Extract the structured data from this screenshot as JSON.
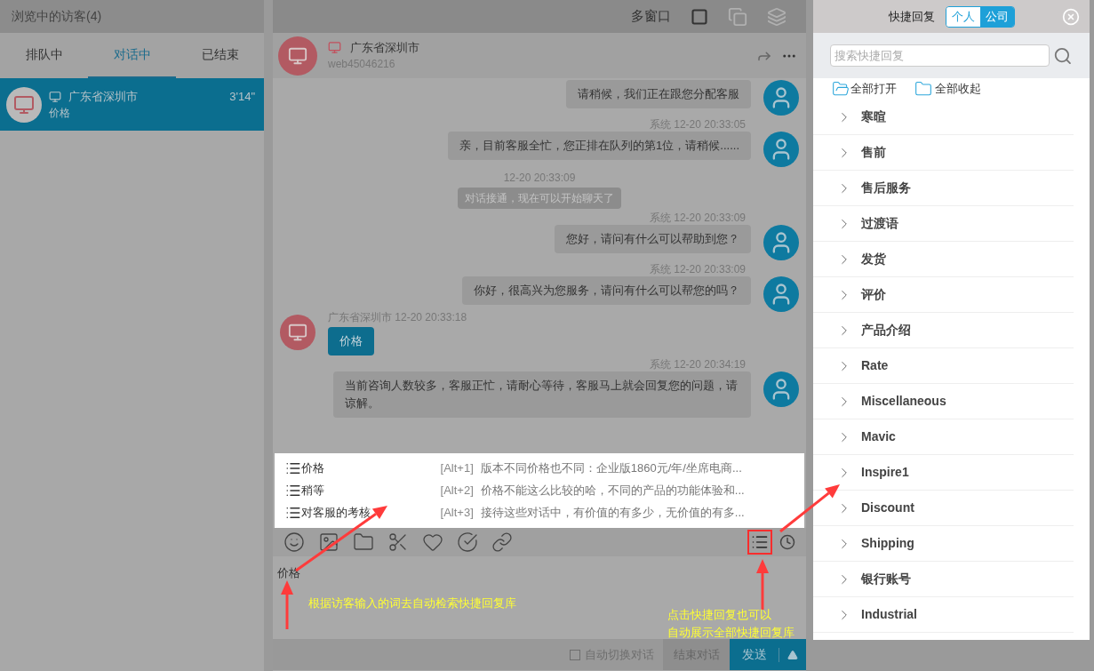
{
  "visitors_panel": {
    "title": "浏览中的访客(4)",
    "tabs": [
      {
        "label": "排队中",
        "selected": false
      },
      {
        "label": "对话中",
        "selected": true
      },
      {
        "label": "已结束",
        "selected": false
      }
    ],
    "sessions": [
      {
        "location": "广东省深圳市",
        "last_message": "价格",
        "duration": "3'14\"",
        "selected": true
      }
    ]
  },
  "chat": {
    "toolbar_label": "多窗口",
    "visitor": {
      "location": "广东省深圳市",
      "id": "web45046216"
    },
    "messages": [
      {
        "kind": "agent",
        "text": "请稍候，我们正在跟您分配客服"
      },
      {
        "kind": "agent",
        "sender": "系统",
        "time": "12-20 20:33:05",
        "text": "亲，目前客服全忙，您正排在队列的第1位，请稍候......"
      },
      {
        "kind": "notice",
        "time": "12-20 20:33:09",
        "text": "对话接通，现在可以开始聊天了"
      },
      {
        "kind": "agent",
        "sender": "系统",
        "time": "12-20 20:33:09",
        "text": "您好，请问有什么可以帮助到您？"
      },
      {
        "kind": "agent",
        "sender": "系统",
        "time": "12-20 20:33:09",
        "text": "你好，很高兴为您服务，请问有什么可以帮您的吗？"
      },
      {
        "kind": "visitor",
        "sender": "广东省深圳市",
        "time": "12-20 20:33:18",
        "text": "价格"
      },
      {
        "kind": "agent",
        "sender": "系统",
        "time": "12-20 20:34:19",
        "text": "当前咨询人数较多，客服正忙，请耐心等待，客服马上就会回复您的问题，请谅解。"
      }
    ],
    "suggestions": [
      {
        "title": "价格",
        "shortcut": "[Alt+1]",
        "preview": "版本不同价格也不同：企业版1860元/年/坐席电商..."
      },
      {
        "title": "稍等",
        "shortcut": "[Alt+2]",
        "preview": "价格不能这么比较的哈，不同的产品的功能体验和..."
      },
      {
        "title": "对客服的考核",
        "shortcut": "[Alt+3]",
        "preview": "接待这些对话中，有价值的有多少，无价值的有多..."
      }
    ],
    "input_value": "价格",
    "auto_switch": {
      "label": "自动切换对话",
      "checked": false
    },
    "end_button": "结束对话",
    "send_button": "发送"
  },
  "quick_replies": {
    "title": "快捷回复",
    "scopes": [
      {
        "label": "个人",
        "selected": false
      },
      {
        "label": "公司",
        "selected": true
      }
    ],
    "search": {
      "placeholder": "搜索快捷回复"
    },
    "expand_all": "全部打开",
    "collapse_all": "全部收起",
    "categories": [
      {
        "label": "寒暄"
      },
      {
        "label": "售前"
      },
      {
        "label": "售后服务"
      },
      {
        "label": "过渡语"
      },
      {
        "label": "发货"
      },
      {
        "label": "评价"
      },
      {
        "label": "产品介绍"
      },
      {
        "label": "Rate"
      },
      {
        "label": "Miscellaneous"
      },
      {
        "label": "Mavic"
      },
      {
        "label": "Inspire1"
      },
      {
        "label": "Discount"
      },
      {
        "label": "Shipping"
      },
      {
        "label": "银行账号"
      },
      {
        "label": "Industrial"
      }
    ]
  },
  "annotations": [
    {
      "lines": [
        "根据访客输入的词去自动检索快捷回复库"
      ]
    },
    {
      "lines": [
        "点击快捷回复也可以",
        "自动展示全部快捷回复库"
      ]
    }
  ]
}
